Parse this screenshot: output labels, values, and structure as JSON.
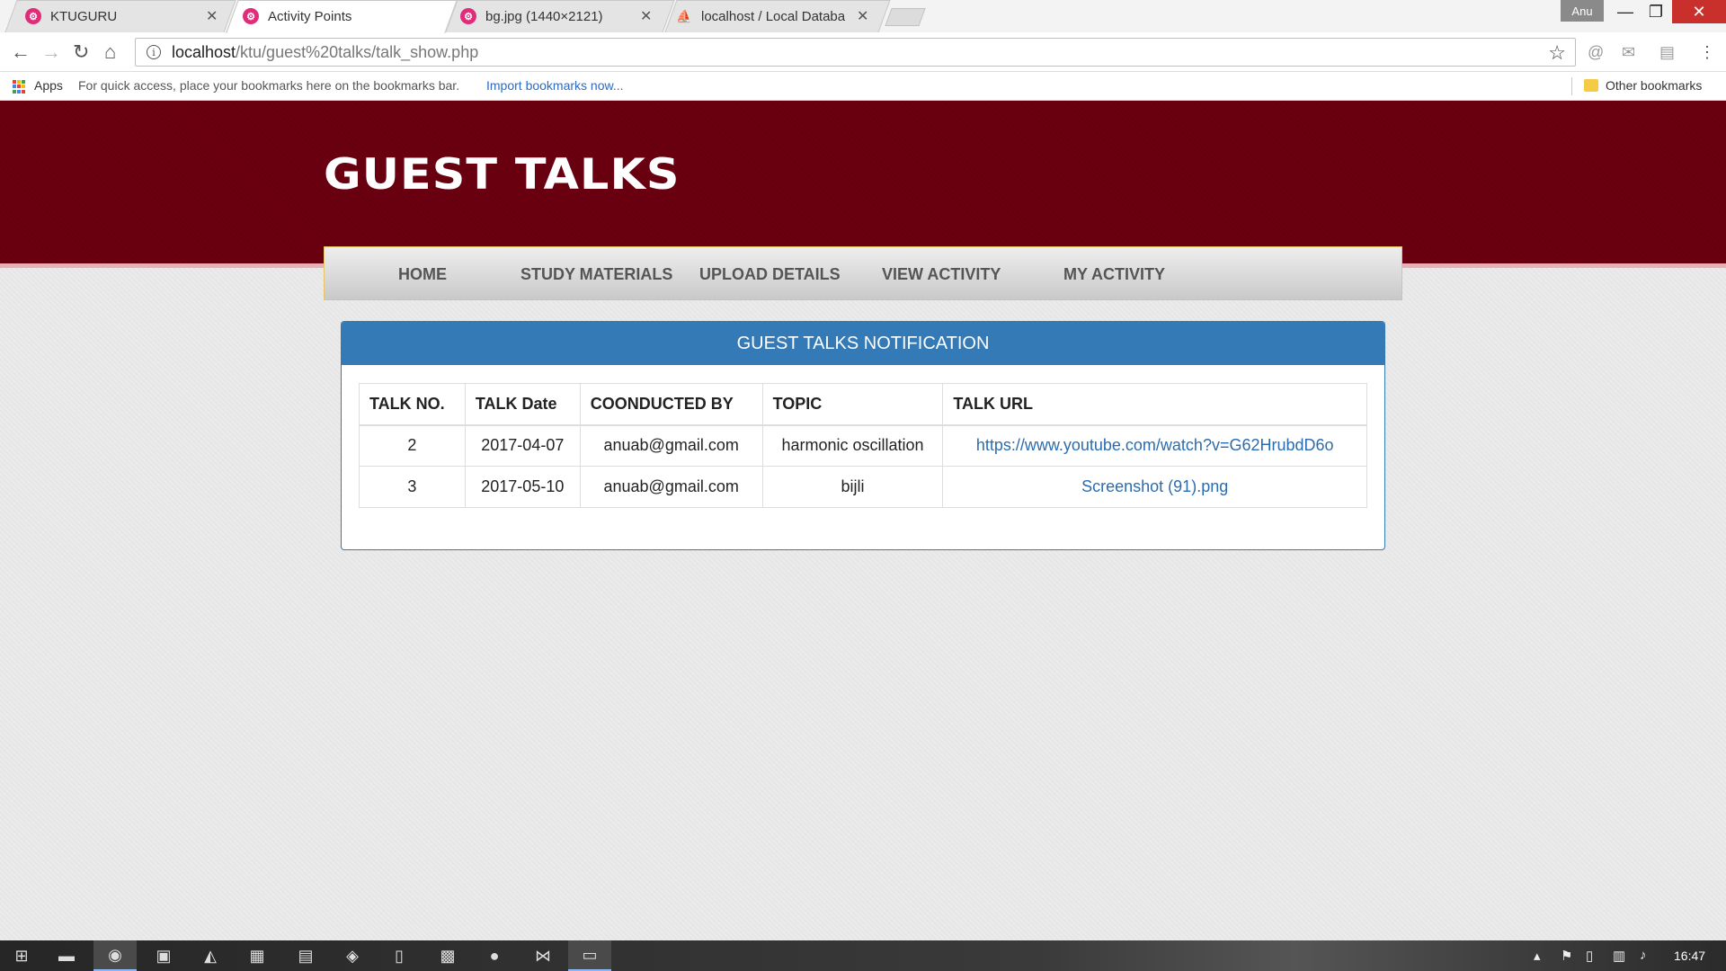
{
  "browser": {
    "tabs": [
      {
        "title": "KTUGURU",
        "favicon": "ktu-icon"
      },
      {
        "title": "Activity Points",
        "favicon": "ktu-icon"
      },
      {
        "title": "bg.jpg (1440×2121)",
        "favicon": "ktu-icon"
      },
      {
        "title": "localhost / Local Databa",
        "favicon": "phpmyadmin-icon"
      }
    ],
    "active_tab": 1,
    "profile_name": "Anu",
    "url_host": "localhost",
    "url_path": "/ktu/guest%20talks/talk_show.php",
    "bookmarks": {
      "apps_label": "Apps",
      "hint": "For quick access, place your bookmarks here on the bookmarks bar.",
      "import_link": "Import bookmarks now...",
      "other": "Other bookmarks"
    }
  },
  "site": {
    "title": "GUEST TALKS",
    "nav": [
      "HOME",
      "STUDY MATERIALS",
      "UPLOAD DETAILS",
      "VIEW ACTIVITY",
      "MY ACTIVITY"
    ]
  },
  "panel": {
    "heading": "GUEST TALKS NOTIFICATION",
    "columns": [
      "TALK NO.",
      "TALK Date",
      "COONDUCTED BY",
      "TOPIC",
      "TALK URL"
    ],
    "rows": [
      [
        "2",
        "2017-04-07",
        "anuab@gmail.com",
        "harmonic oscillation",
        "https://www.youtube.com/watch?v=G62HrubdD6o"
      ],
      [
        "3",
        "2017-05-10",
        "anuab@gmail.com",
        "bijli",
        "Screenshot (91).png"
      ]
    ]
  },
  "taskbar": {
    "clock": "16:47"
  },
  "colors": {
    "header_bg": "#6c0010",
    "panel_head_bg": "#337ab7",
    "link": "#2b6cb0"
  }
}
